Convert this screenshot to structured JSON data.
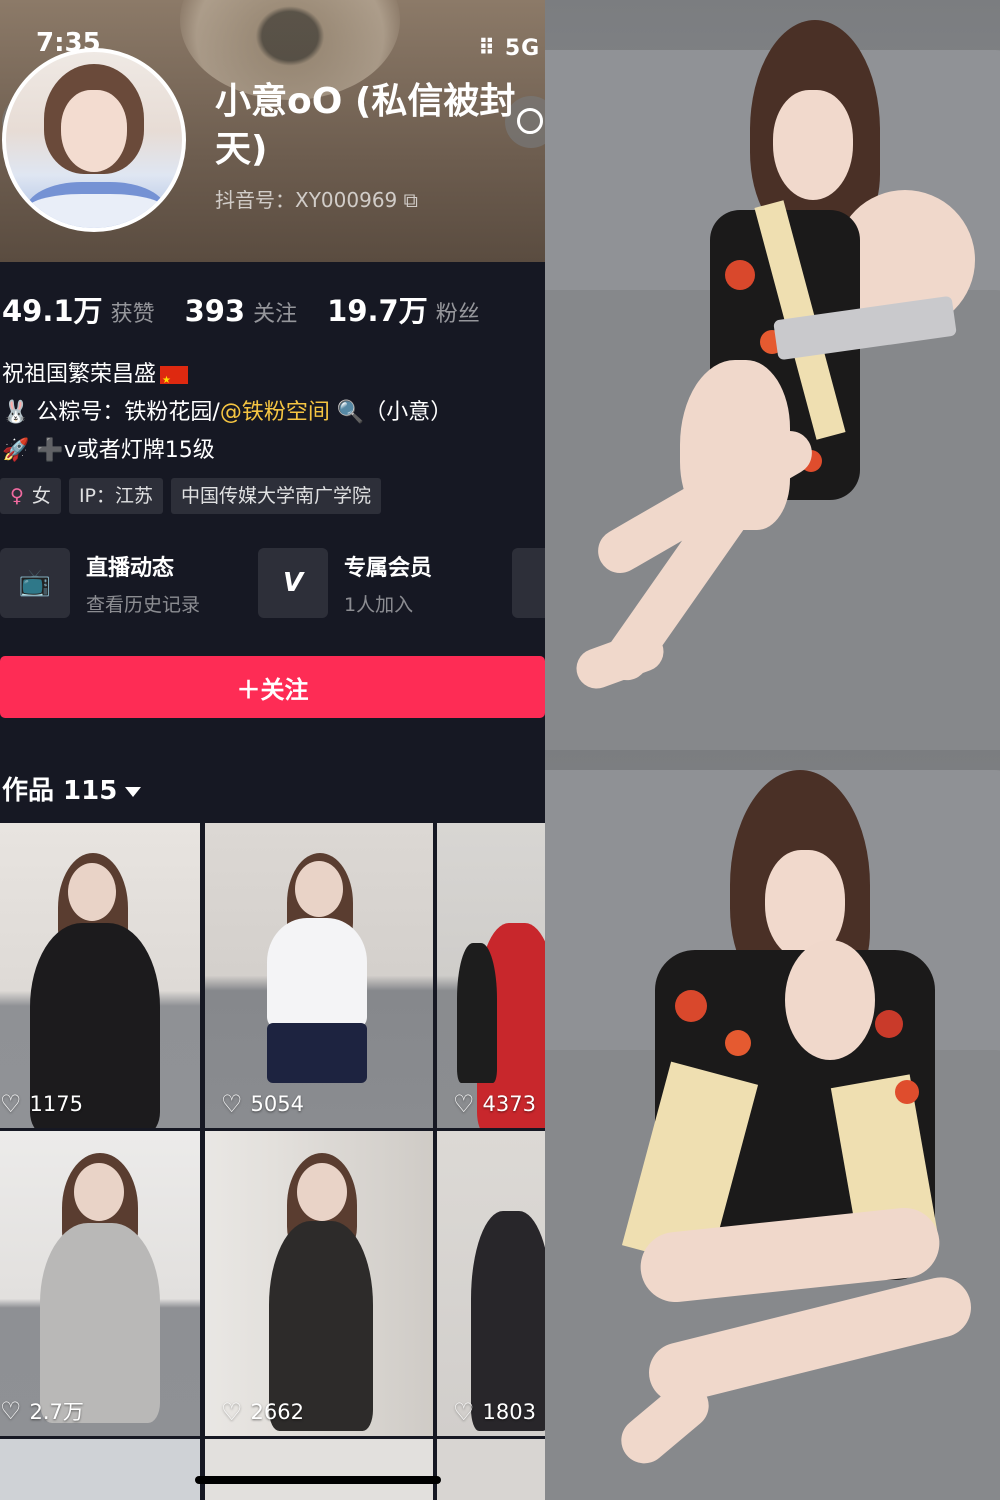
{
  "status_bar": {
    "time": "7:35",
    "signal": "5G"
  },
  "profile": {
    "name": "小意oO (私信被封 天)",
    "douyin_id": "抖音号：XY000969",
    "stats": [
      {
        "value": "49.1万",
        "label": "获赞"
      },
      {
        "value": "393",
        "label": "关注"
      },
      {
        "value": "19.7万",
        "label": "粉丝"
      }
    ],
    "bio": {
      "line1": "祝祖国繁荣昌盛",
      "line2_prefix": "🐰 公粽号：铁粉花园/",
      "line2_highlight": "@铁粉空间",
      "line2_suffix": " 🔍（小意）",
      "line3": "🚀 ➕v或者灯牌15级"
    },
    "tags": [
      {
        "icon": "♀",
        "text": "女"
      },
      {
        "text": "IP：江苏"
      },
      {
        "text": "中国传媒大学南广学院"
      }
    ],
    "cards": [
      {
        "title": "直播动态",
        "subtitle": "查看历史记录",
        "icon": "tv-icon"
      },
      {
        "title": "专属会员",
        "subtitle": "1人加入",
        "icon": "v-icon"
      }
    ],
    "follow_label": "＋关注",
    "works_label": "作品 115"
  },
  "videos": [
    {
      "likes": "1175"
    },
    {
      "likes": "5054"
    },
    {
      "likes": "4373"
    },
    {
      "likes": "2.7万"
    },
    {
      "likes": "2662"
    },
    {
      "likes": "1803"
    }
  ],
  "colors": {
    "accent": "#fe2c55",
    "background": "#161823",
    "highlight": "#f5c542"
  }
}
